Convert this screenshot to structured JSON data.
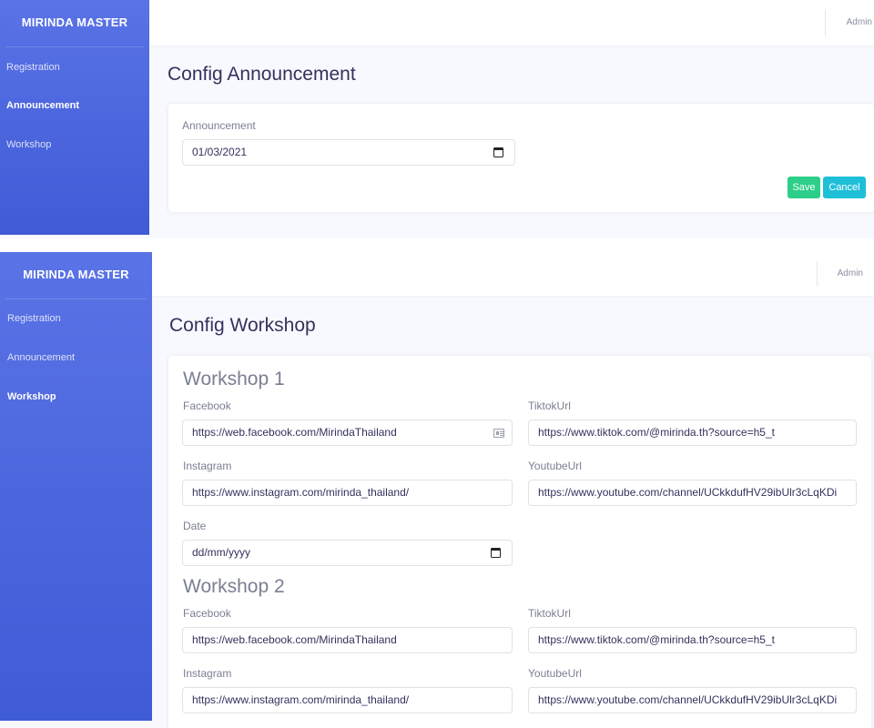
{
  "brand": "MIRINDA MASTER",
  "nav": [
    "Registration",
    "Announcement",
    "Workshop"
  ],
  "user": "Admin",
  "announcement_page": {
    "title": "Config Announcement",
    "field_label": "Announcement",
    "date_value": "01/03/2021",
    "save_label": "Save",
    "cancel_label": "Cancel"
  },
  "workshop_page": {
    "title": "Config Workshop",
    "workshops": [
      {
        "heading": "Workshop 1",
        "facebook_label": "Facebook",
        "facebook_value": "https://web.facebook.com/MirindaThailand",
        "tiktok_label": "TiktokUrl",
        "tiktok_value": "https://www.tiktok.com/@mirinda.th?source=h5_t",
        "instagram_label": "Instagram",
        "instagram_value": "https://www.instagram.com/mirinda_thailand/",
        "youtube_label": "YoutubeUrl",
        "youtube_value": "https://www.youtube.com/channel/UCkkdufHV29ibUlr3cLqKDi",
        "date_label": "Date",
        "date_placeholder": "dd/mm/yyyy"
      },
      {
        "heading": "Workshop 2",
        "facebook_label": "Facebook",
        "facebook_value": "https://web.facebook.com/MirindaThailand",
        "tiktok_label": "TiktokUrl",
        "tiktok_value": "https://www.tiktok.com/@mirinda.th?source=h5_t",
        "instagram_label": "Instagram",
        "instagram_value": "https://www.instagram.com/mirinda_thailand/",
        "youtube_label": "YoutubeUrl",
        "youtube_value": "https://www.youtube.com/channel/UCkkdufHV29ibUlr3cLqKDi"
      }
    ]
  }
}
